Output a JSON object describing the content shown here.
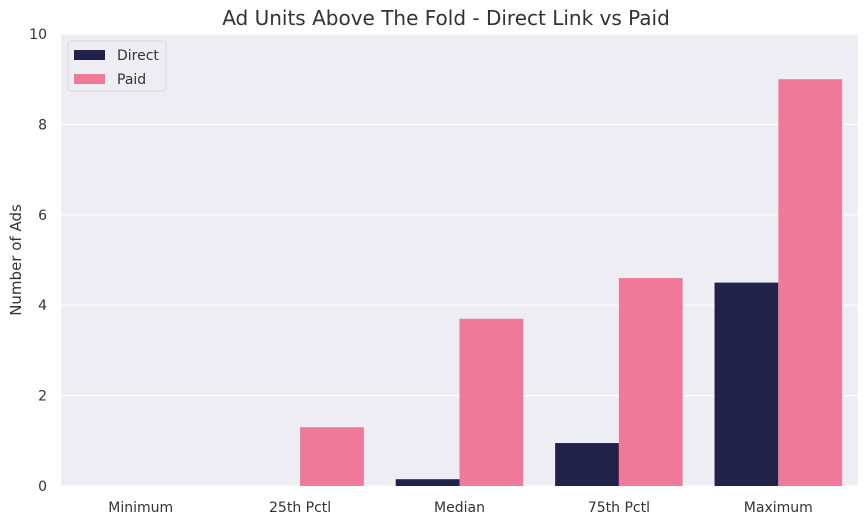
{
  "chart_data": {
    "type": "bar",
    "title": "Ad Units Above The Fold - Direct Link vs Paid",
    "xlabel": "",
    "ylabel": "Number of Ads",
    "categories": [
      "Minimum",
      "25th Pctl",
      "Median",
      "75th Pctl",
      "Maximum"
    ],
    "series": [
      {
        "name": "Direct",
        "color": "#22214a",
        "values": [
          0,
          0,
          0.15,
          0.95,
          4.5
        ]
      },
      {
        "name": "Paid",
        "color": "#ef7998",
        "values": [
          0,
          1.3,
          3.7,
          4.6,
          9.0
        ]
      }
    ],
    "ylim": [
      0,
      10
    ],
    "yticks": [
      0,
      2,
      4,
      6,
      8,
      10
    ],
    "grid": true,
    "legend": "top-left",
    "background": "#eeedf4"
  }
}
